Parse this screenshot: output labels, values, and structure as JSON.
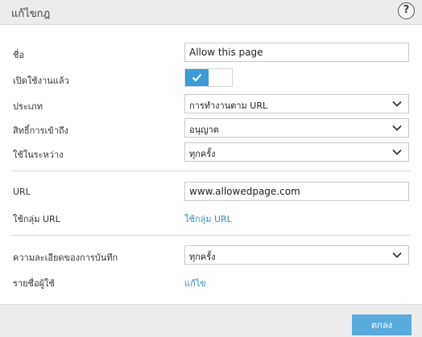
{
  "dialog": {
    "title": "แก้ไขกฎ",
    "help_label": "?"
  },
  "form": {
    "name": {
      "label": "ชื่อ",
      "value": "Allow this page"
    },
    "enabled": {
      "label": "เปิดใช้งานแล้ว",
      "checked": true
    },
    "type": {
      "label": "ประเภท",
      "selected": "การทำงานตาม URL"
    },
    "access": {
      "label": "สิทธิ์การเข้าถึง",
      "selected": "อนุญาต"
    },
    "apply_during": {
      "label": "ใช้ในระหว่าง",
      "selected": "ทุกครั้ง"
    },
    "url": {
      "label": "URL",
      "value": "www.allowedpage.com"
    },
    "url_group": {
      "label": "ใช้กลุ่ม URL",
      "link": "ใช้กลุ่ม URL"
    },
    "log_verbosity": {
      "label": "ความละเอียดของการบันทึก",
      "selected": "ทุกครั้ง"
    },
    "user_list": {
      "label": "รายชื่อผู้ใช้",
      "link": "แก้ไข"
    }
  },
  "footer": {
    "ok_label": "ตกลง"
  },
  "colors": {
    "accent": "#3d9bd6",
    "link": "#2e8fcf",
    "button": "#5aabdd",
    "header_bg": "#ececec"
  },
  "icons": {
    "help": "question-circle-icon",
    "toggle": "checkmark-icon",
    "dropdown": "chevron-down-icon"
  }
}
